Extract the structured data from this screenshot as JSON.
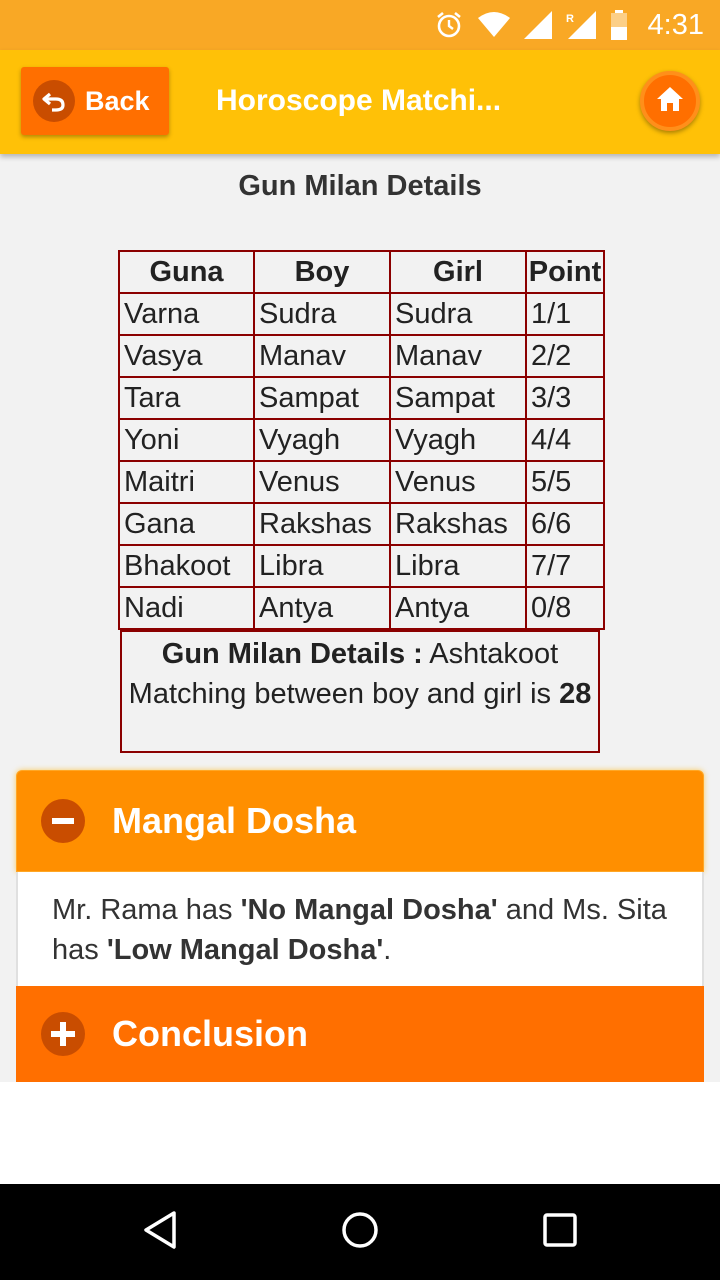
{
  "status_bar": {
    "time": "4:31",
    "icons": [
      "alarm-icon",
      "wifi-icon",
      "cell-signal-icon",
      "roaming-signal-icon",
      "battery-icon"
    ]
  },
  "app_bar": {
    "back_label": "Back",
    "title": "Horoscope Matchi...",
    "home_icon": "home-icon"
  },
  "section_title": "Gun Milan Details",
  "gun_table": {
    "headers": [
      "Guna",
      "Boy",
      "Girl",
      "Point"
    ],
    "rows": [
      [
        "Varna",
        "Sudra",
        "Sudra",
        "1/1"
      ],
      [
        "Vasya",
        "Manav",
        "Manav",
        "2/2"
      ],
      [
        "Tara",
        "Sampat",
        "Sampat",
        "3/3"
      ],
      [
        "Yoni",
        "Vyagh",
        "Vyagh",
        "4/4"
      ],
      [
        "Maitri",
        "Venus",
        "Venus",
        "5/5"
      ],
      [
        "Gana",
        "Rakshas",
        "Rakshas",
        "6/6"
      ],
      [
        "Bhakoot",
        "Libra",
        "Libra",
        "7/7"
      ],
      [
        "Nadi",
        "Antya",
        "Antya",
        "0/8"
      ]
    ]
  },
  "summary": {
    "label": "Gun Milan Details :",
    "text": " Ashtakoot Matching between boy and girl is ",
    "score": "28"
  },
  "mangal_dosha": {
    "title": "Mangal Dosha",
    "expanded": true,
    "text_1": "Mr. Rama has ",
    "boy_status": "'No Mangal Dosha'",
    "text_2": " and Ms. Sita has ",
    "girl_status": "'Low Mangal Dosha'",
    "text_3": "."
  },
  "conclusion": {
    "title": "Conclusion",
    "expanded": false
  },
  "colors": {
    "status_bar": "#f9a825",
    "app_bar": "#ffc107",
    "accent": "#ff6f00",
    "table_border": "#8b0000"
  }
}
